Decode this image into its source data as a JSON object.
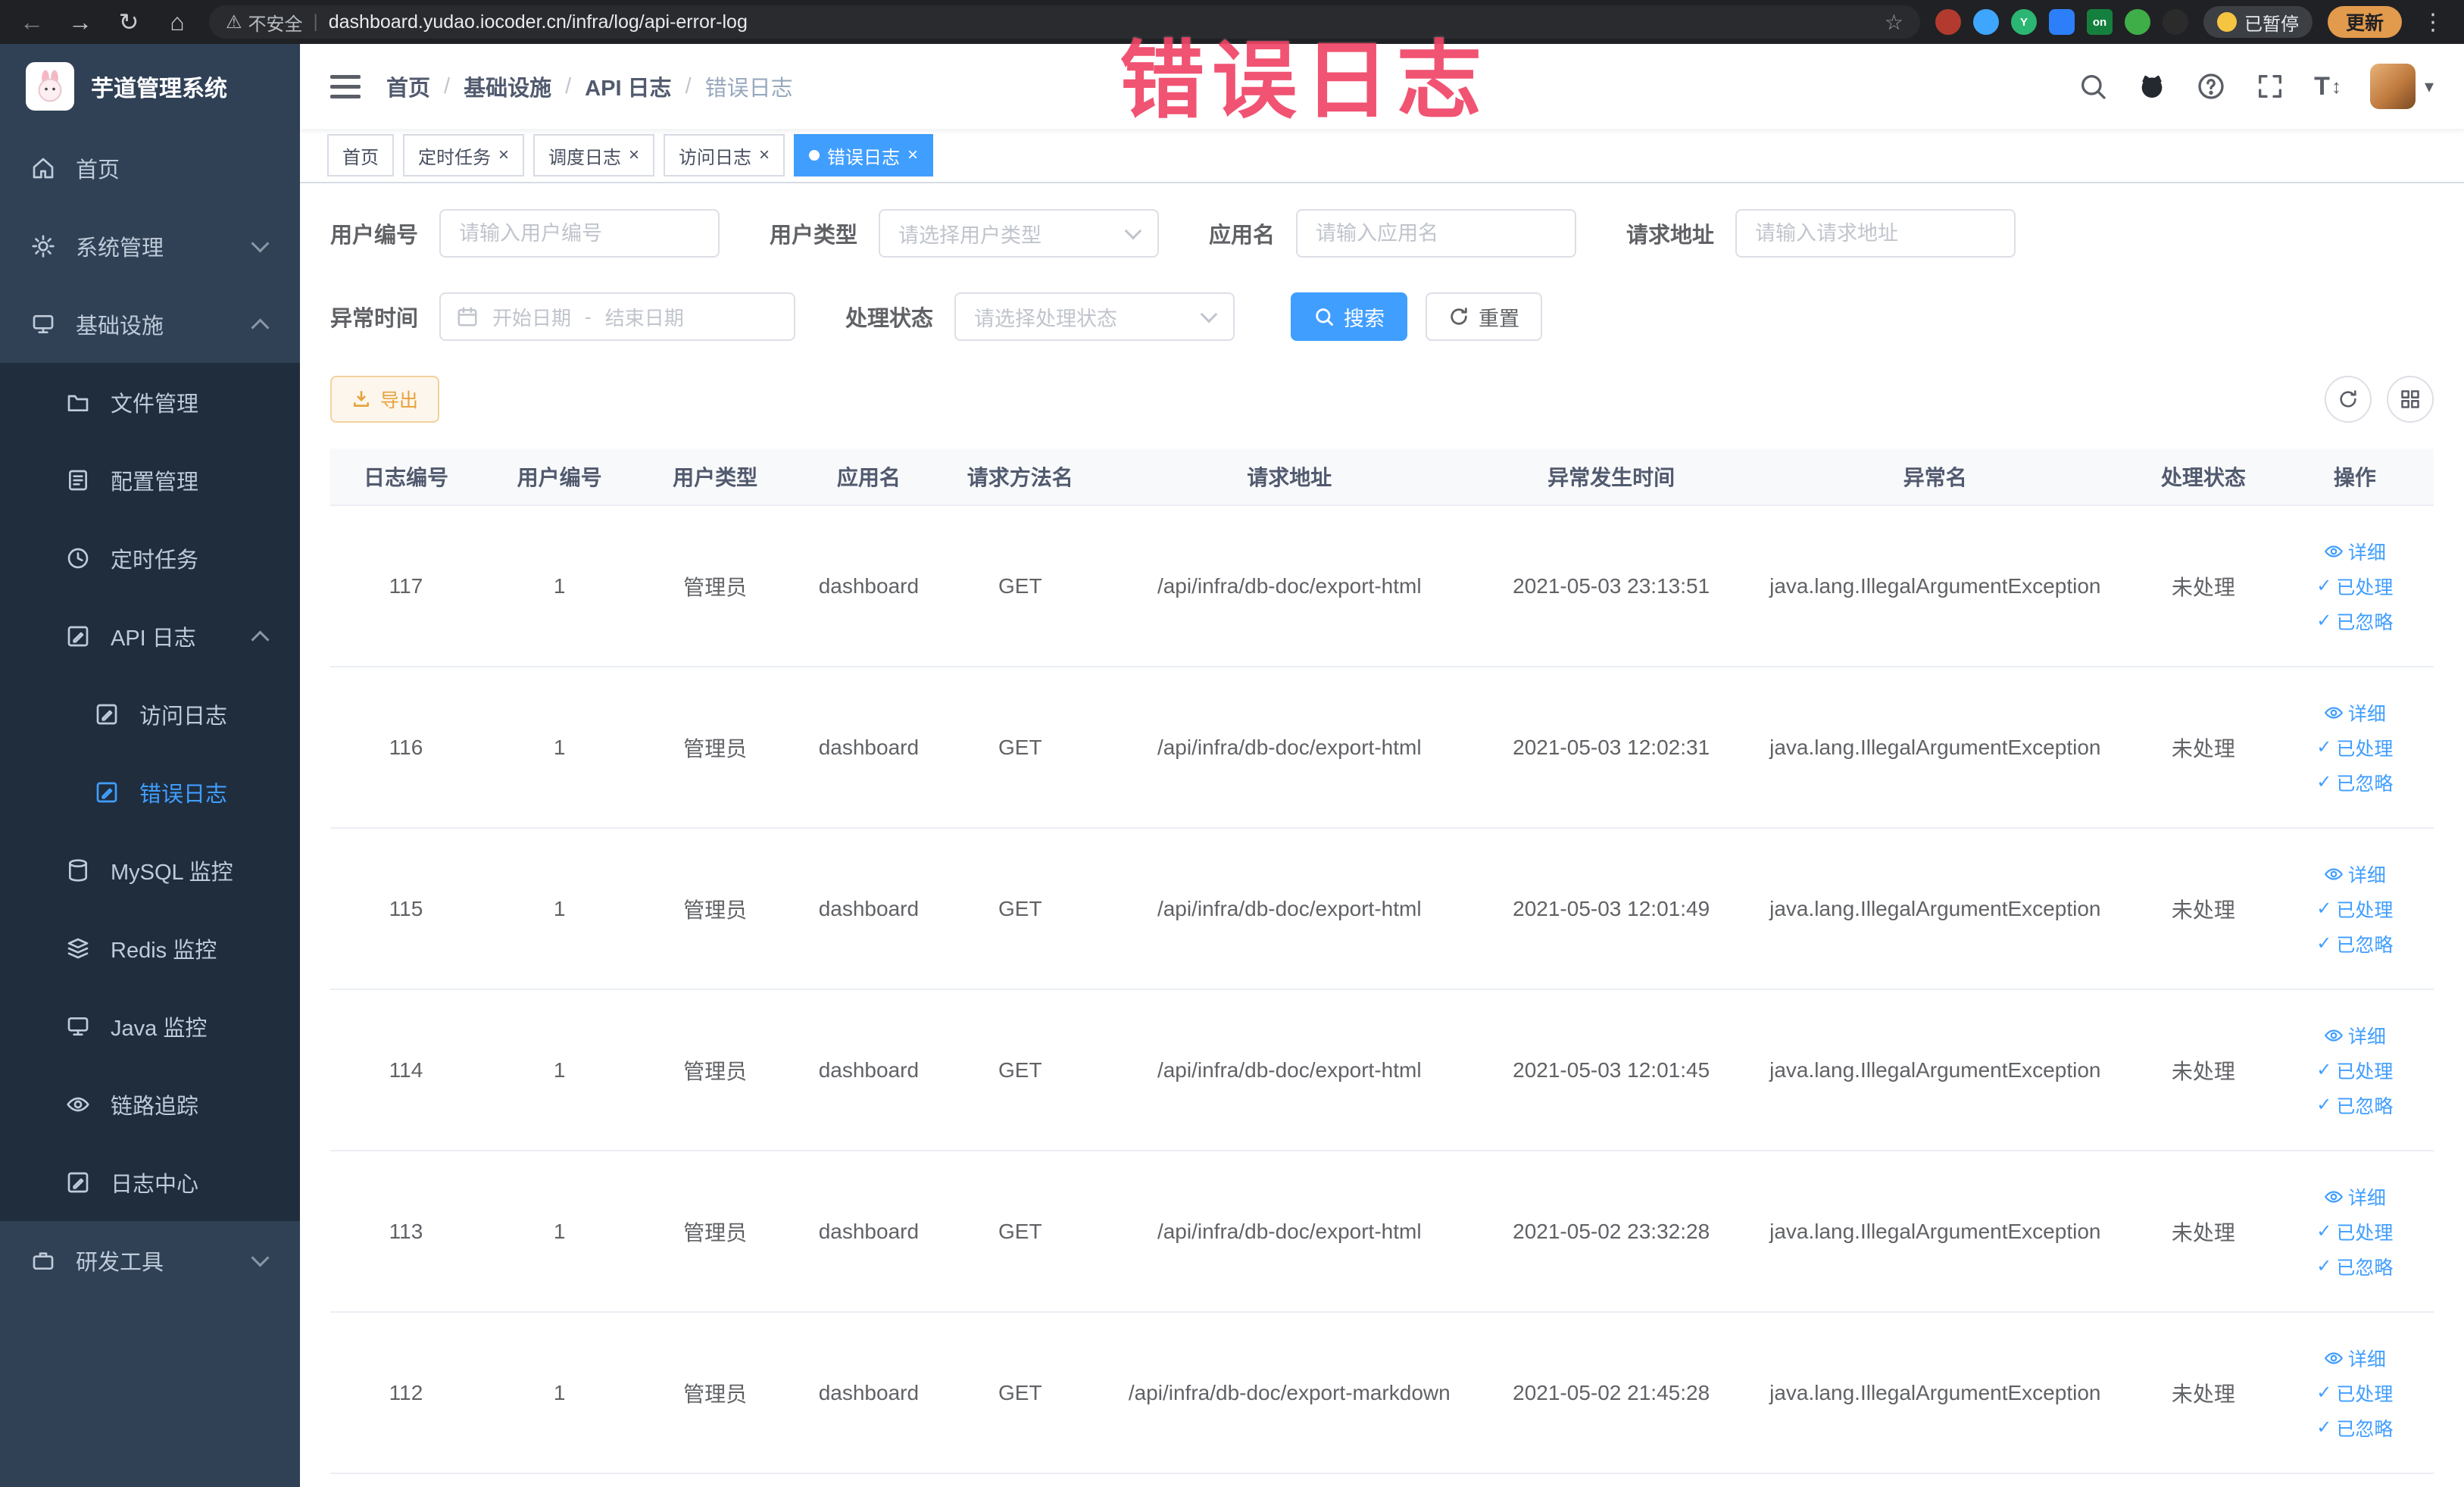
{
  "colors": {
    "accent": "#409eff",
    "warning": "#e6a23c",
    "annotation_red": "#ef3b5f",
    "sidebar_bg": "#304156",
    "submenu_bg": "#1f2d3d"
  },
  "icons": {
    "back": "←",
    "forward": "→",
    "reload": "↻",
    "home": "⌂",
    "warning": "⚠",
    "star": "☆",
    "overflow_menu": "⋮",
    "caret_down": "▾",
    "check": "✓",
    "text_size": "T",
    "updown": "↕",
    "close": "×",
    "tab_close": "×",
    "ext_on": "on",
    "ext_y": "Y"
  },
  "browser": {
    "security_label": "不安全",
    "divider": "|",
    "url": "dashboard.yudao.iocoder.cn/infra/log/api-error-log",
    "paused_label": "已暂停",
    "update_label": "更新"
  },
  "annotation": {
    "text": "错误日志"
  },
  "sidebar": {
    "logo_title": "芋道管理系统",
    "items": [
      {
        "label": "首页"
      },
      {
        "label": "系统管理"
      },
      {
        "label": "基础设施"
      },
      {
        "label": "文件管理"
      },
      {
        "label": "配置管理"
      },
      {
        "label": "定时任务"
      },
      {
        "label": "API 日志"
      },
      {
        "label": "访问日志"
      },
      {
        "label": "错误日志"
      },
      {
        "label": "MySQL 监控"
      },
      {
        "label": "Redis 监控"
      },
      {
        "label": "Java 监控"
      },
      {
        "label": "链路追踪"
      },
      {
        "label": "日志中心"
      },
      {
        "label": "研发工具"
      }
    ]
  },
  "header": {
    "breadcrumb": [
      "首页",
      "基础设施",
      "API 日志",
      "错误日志"
    ],
    "separator": "/"
  },
  "tabs": [
    {
      "label": "首页"
    },
    {
      "label": "定时任务"
    },
    {
      "label": "调度日志"
    },
    {
      "label": "访问日志"
    },
    {
      "label": "错误日志"
    }
  ],
  "filters": {
    "user_id": {
      "label": "用户编号",
      "placeholder": "请输入用户编号"
    },
    "user_type": {
      "label": "用户类型",
      "placeholder": "请选择用户类型"
    },
    "app_name": {
      "label": "应用名",
      "placeholder": "请输入应用名"
    },
    "request_url": {
      "label": "请求地址",
      "placeholder": "请输入请求地址"
    },
    "exception_time": {
      "label": "异常时间",
      "start_placeholder": "开始日期",
      "separator": "-",
      "end_placeholder": "结束日期"
    },
    "process_status": {
      "label": "处理状态",
      "placeholder": "请选择处理状态"
    },
    "search_label": "搜索",
    "reset_label": "重置"
  },
  "toolbar": {
    "export_label": "导出"
  },
  "table": {
    "columns": [
      "日志编号",
      "用户编号",
      "用户类型",
      "应用名",
      "请求方法名",
      "请求地址",
      "异常发生时间",
      "异常名",
      "处理状态",
      "操作"
    ],
    "ops": {
      "detail": "详细",
      "processed": "已处理",
      "ignored": "已忽略"
    },
    "rows": [
      {
        "id": "117",
        "user_id": "1",
        "user_type": "管理员",
        "app_name": "dashboard",
        "method": "GET",
        "url": "/api/infra/db-doc/export-html",
        "time": "2021-05-03 23:13:51",
        "exception": "java.lang.IllegalArgumentException",
        "status": "未处理"
      },
      {
        "id": "116",
        "user_id": "1",
        "user_type": "管理员",
        "app_name": "dashboard",
        "method": "GET",
        "url": "/api/infra/db-doc/export-html",
        "time": "2021-05-03 12:02:31",
        "exception": "java.lang.IllegalArgumentException",
        "status": "未处理"
      },
      {
        "id": "115",
        "user_id": "1",
        "user_type": "管理员",
        "app_name": "dashboard",
        "method": "GET",
        "url": "/api/infra/db-doc/export-html",
        "time": "2021-05-03 12:01:49",
        "exception": "java.lang.IllegalArgumentException",
        "status": "未处理"
      },
      {
        "id": "114",
        "user_id": "1",
        "user_type": "管理员",
        "app_name": "dashboard",
        "method": "GET",
        "url": "/api/infra/db-doc/export-html",
        "time": "2021-05-03 12:01:45",
        "exception": "java.lang.IllegalArgumentException",
        "status": "未处理"
      },
      {
        "id": "113",
        "user_id": "1",
        "user_type": "管理员",
        "app_name": "dashboard",
        "method": "GET",
        "url": "/api/infra/db-doc/export-html",
        "time": "2021-05-02 23:32:28",
        "exception": "java.lang.IllegalArgumentException",
        "status": "未处理"
      },
      {
        "id": "112",
        "user_id": "1",
        "user_type": "管理员",
        "app_name": "dashboard",
        "method": "GET",
        "url": "/api/infra/db-doc/export-markdown",
        "time": "2021-05-02 21:45:28",
        "exception": "java.lang.IllegalArgumentException",
        "status": "未处理"
      }
    ]
  }
}
